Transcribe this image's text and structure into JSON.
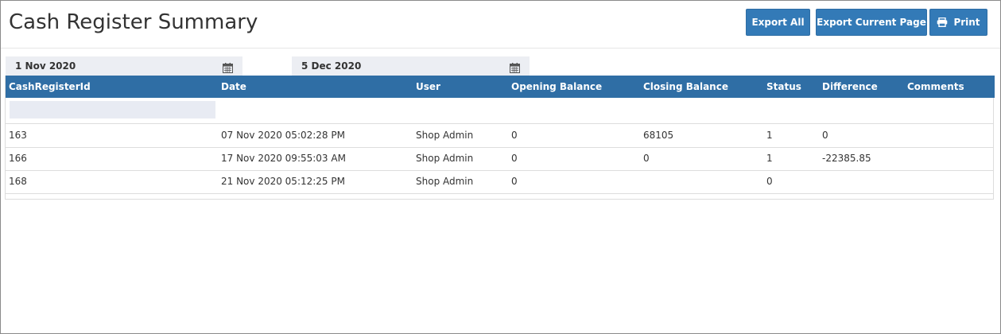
{
  "page": {
    "title": "Cash Register Summary"
  },
  "toolbar": {
    "export_all_label": "Export All",
    "export_current_page_label": "Export Current Page",
    "print_label": "Print",
    "print_icon": "printer-icon"
  },
  "filters": {
    "date_from": "1 Nov 2020",
    "date_to": "5 Dec 2020",
    "date_icon": "calendar-icon",
    "id_filter_value": ""
  },
  "table": {
    "columns": [
      "CashRegisterId",
      "Date",
      "User",
      "Opening Balance",
      "Closing Balance",
      "Status",
      "Difference",
      "Comments"
    ],
    "rows": [
      [
        "163",
        "07 Nov 2020 05:02:28 PM",
        "Shop Admin",
        "0",
        "68105",
        "1",
        "0",
        ""
      ],
      [
        "166",
        "17 Nov 2020 09:55:03 AM",
        "Shop Admin",
        "0",
        "0",
        "1",
        "-22385.85",
        ""
      ],
      [
        "168",
        "21 Nov 2020 05:12:25 PM",
        "Shop Admin",
        "0",
        "",
        "0",
        "",
        ""
      ]
    ]
  },
  "colors": {
    "button_bg": "#337ab7",
    "header_bg": "#2f6ea5",
    "date_box_bg": "#eceef3"
  }
}
